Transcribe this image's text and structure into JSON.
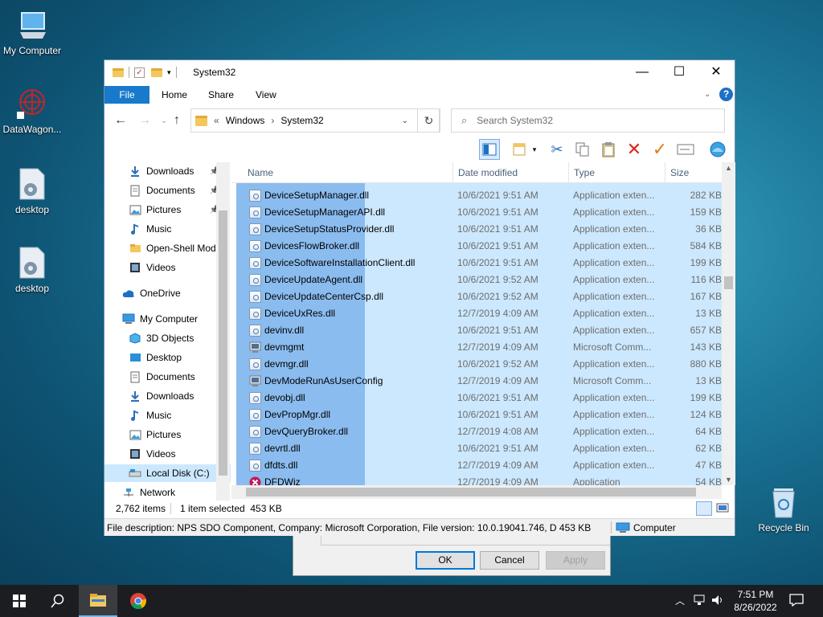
{
  "desktop": {
    "icons": [
      {
        "label": "My Computer"
      },
      {
        "label": "DataWagon..."
      },
      {
        "label": "desktop"
      },
      {
        "label": "desktop"
      },
      {
        "label": "Recycle Bin"
      }
    ]
  },
  "dialog": {
    "ok_label": "OK",
    "cancel_label": "Cancel",
    "apply_label": "Apply"
  },
  "window": {
    "title": "System32",
    "minimize": "—",
    "maximize": "☐",
    "close": "✕",
    "help": "?"
  },
  "ribbon": {
    "tabs": [
      {
        "label": "File"
      },
      {
        "label": "Home"
      },
      {
        "label": "Share"
      },
      {
        "label": "View"
      }
    ]
  },
  "address": {
    "overflow": "«",
    "crumbs": [
      {
        "label": "Windows"
      },
      {
        "label": "System32"
      }
    ],
    "separator": "›",
    "search_placeholder": "Search System32"
  },
  "nav": {
    "items": [
      {
        "label": "Downloads",
        "icon": "download-arrow-icon",
        "pinned": true
      },
      {
        "label": "Documents",
        "icon": "document-icon",
        "pinned": true
      },
      {
        "label": "Pictures",
        "icon": "picture-icon",
        "pinned": true
      },
      {
        "label": "Music",
        "icon": "music-note-icon",
        "pinned": false
      },
      {
        "label": "Open-Shell Mod",
        "icon": "folder-icon",
        "pinned": false
      },
      {
        "label": "Videos",
        "icon": "video-icon",
        "pinned": false
      },
      {
        "label": "OneDrive",
        "icon": "cloud-icon",
        "pinned": false
      },
      {
        "label": "My Computer",
        "icon": "computer-icon",
        "pinned": false
      },
      {
        "label": "3D Objects",
        "icon": "cube-icon",
        "pinned": false
      },
      {
        "label": "Desktop",
        "icon": "desktop-icon",
        "pinned": false
      },
      {
        "label": "Documents",
        "icon": "document-icon",
        "pinned": false
      },
      {
        "label": "Downloads",
        "icon": "download-arrow-icon",
        "pinned": false
      },
      {
        "label": "Music",
        "icon": "music-note-icon",
        "pinned": false
      },
      {
        "label": "Pictures",
        "icon": "picture-icon",
        "pinned": false
      },
      {
        "label": "Videos",
        "icon": "video-icon",
        "pinned": false
      },
      {
        "label": "Local Disk (C:)",
        "icon": "drive-icon",
        "pinned": false
      },
      {
        "label": "Network",
        "icon": "network-icon",
        "pinned": false
      }
    ]
  },
  "columns": [
    {
      "label": "Name"
    },
    {
      "label": "Date modified"
    },
    {
      "label": "Type"
    },
    {
      "label": "Size"
    }
  ],
  "files": [
    {
      "name": "DeviceSetupManager.dll",
      "date": "10/6/2021 9:51 AM",
      "type": "Application exten...",
      "size": "282 KB",
      "icon": "dll-icon"
    },
    {
      "name": "DeviceSetupManagerAPI.dll",
      "date": "10/6/2021 9:51 AM",
      "type": "Application exten...",
      "size": "159 KB",
      "icon": "dll-icon"
    },
    {
      "name": "DeviceSetupStatusProvider.dll",
      "date": "10/6/2021 9:51 AM",
      "type": "Application exten...",
      "size": "36 KB",
      "icon": "dll-icon"
    },
    {
      "name": "DevicesFlowBroker.dll",
      "date": "10/6/2021 9:51 AM",
      "type": "Application exten...",
      "size": "584 KB",
      "icon": "dll-icon"
    },
    {
      "name": "DeviceSoftwareInstallationClient.dll",
      "date": "10/6/2021 9:51 AM",
      "type": "Application exten...",
      "size": "199 KB",
      "icon": "dll-icon"
    },
    {
      "name": "DeviceUpdateAgent.dll",
      "date": "10/6/2021 9:52 AM",
      "type": "Application exten...",
      "size": "116 KB",
      "icon": "dll-icon"
    },
    {
      "name": "DeviceUpdateCenterCsp.dll",
      "date": "10/6/2021 9:52 AM",
      "type": "Application exten...",
      "size": "167 KB",
      "icon": "dll-icon"
    },
    {
      "name": "DeviceUxRes.dll",
      "date": "12/7/2019 4:09 AM",
      "type": "Application exten...",
      "size": "13 KB",
      "icon": "dll-icon"
    },
    {
      "name": "devinv.dll",
      "date": "10/6/2021 9:51 AM",
      "type": "Application exten...",
      "size": "657 KB",
      "icon": "dll-icon"
    },
    {
      "name": "devmgmt",
      "date": "12/7/2019 4:09 AM",
      "type": "Microsoft Comm...",
      "size": "143 KB",
      "icon": "msc-icon"
    },
    {
      "name": "devmgr.dll",
      "date": "10/6/2021 9:52 AM",
      "type": "Application exten...",
      "size": "880 KB",
      "icon": "dll-icon"
    },
    {
      "name": "DevModeRunAsUserConfig",
      "date": "12/7/2019 4:09 AM",
      "type": "Microsoft Comm...",
      "size": "13 KB",
      "icon": "msc-icon"
    },
    {
      "name": "devobj.dll",
      "date": "10/6/2021 9:51 AM",
      "type": "Application exten...",
      "size": "199 KB",
      "icon": "dll-icon"
    },
    {
      "name": "DevPropMgr.dll",
      "date": "10/6/2021 9:51 AM",
      "type": "Application exten...",
      "size": "124 KB",
      "icon": "dll-icon"
    },
    {
      "name": "DevQueryBroker.dll",
      "date": "12/7/2019 4:08 AM",
      "type": "Application exten...",
      "size": "64 KB",
      "icon": "dll-icon"
    },
    {
      "name": "devrtl.dll",
      "date": "10/6/2021 9:51 AM",
      "type": "Application exten...",
      "size": "62 KB",
      "icon": "dll-icon"
    },
    {
      "name": "dfdts.dll",
      "date": "12/7/2019 4:09 AM",
      "type": "Application exten...",
      "size": "47 KB",
      "icon": "dll-icon"
    },
    {
      "name": "DFDWiz",
      "date": "12/7/2019 4:09 AM",
      "type": "Application",
      "size": "54 KB",
      "icon": "error-x-icon"
    }
  ],
  "status": {
    "item_count": "2,762 items",
    "selected": "1 item selected  453 KB"
  },
  "infobar": {
    "description": "File description: NPS SDO Component, Company: Microsoft Corporation, File version: 10.0.19041.746, D 453 KB",
    "location": "Computer"
  },
  "taskbar": {
    "time": "7:51 PM",
    "date": "8/26/2022"
  },
  "colors": {
    "accent": "#0078d7",
    "selection": "#cce8ff",
    "selection_strong": "#8bbcef",
    "file_tab": "#1979ca",
    "taskbar": "#1b1d21"
  }
}
